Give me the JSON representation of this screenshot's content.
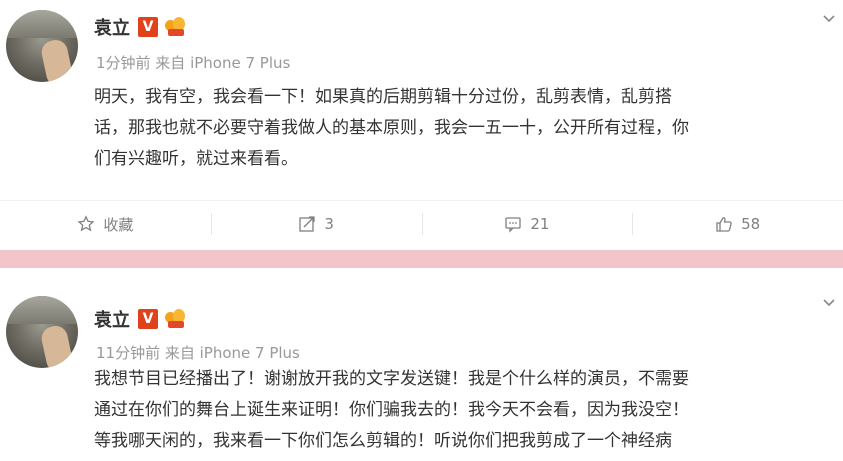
{
  "posts": [
    {
      "author": "袁立",
      "verified_badge": "V",
      "meta": "1分钟前 来自 iPhone 7 Plus",
      "text_lines": [
        "明天，我有空，我会看一下！如果真的后期剪辑十分过份，乱剪表情，乱剪搭",
        "话，那我也就不必要守着我做人的基本原则，我会一五一十，公开所有过程，你",
        "们有兴趣听，就过来看看。"
      ],
      "actions": {
        "favorite": "收藏",
        "repost": "3",
        "comment": "21",
        "like": "58"
      }
    },
    {
      "author": "袁立",
      "verified_badge": "V",
      "meta": "11分钟前 来自 iPhone 7 Plus",
      "text_lines": [
        "我想节目已经播出了！谢谢放开我的文字发送键！我是个什么样的演员，不需要",
        "通过在你们的舞台上诞生来证明！你们骗我去的！我今天不会看，因为我没空！",
        "等我哪天闲的，我来看一下你们怎么剪辑的！听说你们把我剪成了一个神经病"
      ]
    }
  ],
  "colors": {
    "divider": "#f2c5cb",
    "verified": "#e0421b",
    "meta": "#999999"
  },
  "icons": [
    "chevron-down-icon",
    "star-icon",
    "repost-icon",
    "comment-icon",
    "thumbs-up-icon",
    "verified-badge-icon",
    "medal-icon"
  ]
}
